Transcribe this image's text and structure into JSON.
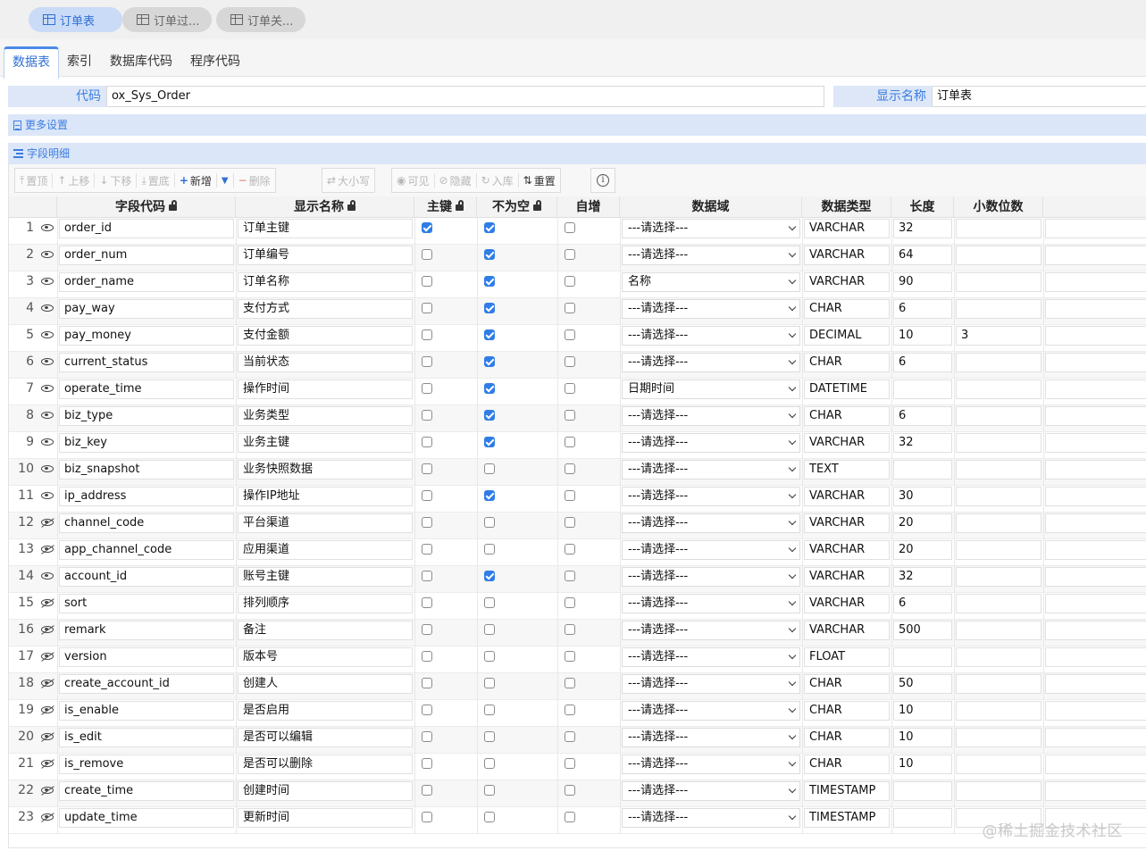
{
  "top_tabs": [
    {
      "label": "订单表",
      "active": true
    },
    {
      "label": "订单过...",
      "active": false
    },
    {
      "label": "订单关...",
      "active": false
    }
  ],
  "sub_tabs": [
    "数据表",
    "索引",
    "数据库代码",
    "程序代码"
  ],
  "form": {
    "code_label": "代码",
    "code_value": "ox_Sys_Order",
    "display_label": "显示名称",
    "display_value": "订单表"
  },
  "sections": {
    "more_settings": "更多设置",
    "field_detail": "字段明细"
  },
  "toolbar": {
    "top": "置顶",
    "up": "上移",
    "down": "下移",
    "bottom": "置底",
    "add": "新增",
    "delete": "删除",
    "case": "大小写",
    "visible": "可见",
    "hide": "隐藏",
    "into_db": "入库",
    "reset": "重置"
  },
  "columns": {
    "code": "字段代码",
    "name": "显示名称",
    "pk": "主键",
    "not_null": "不为空",
    "auto": "自增",
    "domain": "数据域",
    "type": "数据类型",
    "length": "长度",
    "scale": "小数位数"
  },
  "rows": [
    {
      "num": "1",
      "visible": true,
      "code": "order_id",
      "name": "订单主键",
      "pk": true,
      "not_null": true,
      "auto": false,
      "domain": "---请选择---",
      "type": "VARCHAR",
      "length": "32",
      "scale": ""
    },
    {
      "num": "2",
      "visible": true,
      "code": "order_num",
      "name": "订单编号",
      "pk": false,
      "not_null": true,
      "auto": false,
      "domain": "---请选择---",
      "type": "VARCHAR",
      "length": "64",
      "scale": ""
    },
    {
      "num": "3",
      "visible": true,
      "code": "order_name",
      "name": "订单名称",
      "pk": false,
      "not_null": true,
      "auto": false,
      "domain": "名称",
      "type": "VARCHAR",
      "length": "90",
      "scale": ""
    },
    {
      "num": "4",
      "visible": true,
      "code": "pay_way",
      "name": "支付方式",
      "pk": false,
      "not_null": true,
      "auto": false,
      "domain": "---请选择---",
      "type": "CHAR",
      "length": "6",
      "scale": ""
    },
    {
      "num": "5",
      "visible": true,
      "code": "pay_money",
      "name": "支付金额",
      "pk": false,
      "not_null": true,
      "auto": false,
      "domain": "---请选择---",
      "type": "DECIMAL",
      "length": "10",
      "scale": "3"
    },
    {
      "num": "6",
      "visible": true,
      "code": "current_status",
      "name": "当前状态",
      "pk": false,
      "not_null": true,
      "auto": false,
      "domain": "---请选择---",
      "type": "CHAR",
      "length": "6",
      "scale": ""
    },
    {
      "num": "7",
      "visible": true,
      "code": "operate_time",
      "name": "操作时间",
      "pk": false,
      "not_null": true,
      "auto": false,
      "domain": "日期时间",
      "type": "DATETIME",
      "length": "",
      "scale": ""
    },
    {
      "num": "8",
      "visible": true,
      "code": "biz_type",
      "name": "业务类型",
      "pk": false,
      "not_null": true,
      "auto": false,
      "domain": "---请选择---",
      "type": "CHAR",
      "length": "6",
      "scale": ""
    },
    {
      "num": "9",
      "visible": true,
      "code": "biz_key",
      "name": "业务主键",
      "pk": false,
      "not_null": true,
      "auto": false,
      "domain": "---请选择---",
      "type": "VARCHAR",
      "length": "32",
      "scale": ""
    },
    {
      "num": "10",
      "visible": true,
      "code": "biz_snapshot",
      "name": "业务快照数据",
      "pk": false,
      "not_null": false,
      "auto": false,
      "domain": "---请选择---",
      "type": "TEXT",
      "length": "",
      "scale": ""
    },
    {
      "num": "11",
      "visible": true,
      "code": "ip_address",
      "name": "操作IP地址",
      "pk": false,
      "not_null": true,
      "auto": false,
      "domain": "---请选择---",
      "type": "VARCHAR",
      "length": "30",
      "scale": ""
    },
    {
      "num": "12",
      "visible": false,
      "code": "channel_code",
      "name": "平台渠道",
      "pk": false,
      "not_null": false,
      "auto": false,
      "domain": "---请选择---",
      "type": "VARCHAR",
      "length": "20",
      "scale": ""
    },
    {
      "num": "13",
      "visible": false,
      "code": "app_channel_code",
      "name": "应用渠道",
      "pk": false,
      "not_null": false,
      "auto": false,
      "domain": "---请选择---",
      "type": "VARCHAR",
      "length": "20",
      "scale": ""
    },
    {
      "num": "14",
      "visible": true,
      "code": "account_id",
      "name": "账号主键",
      "pk": false,
      "not_null": true,
      "auto": false,
      "domain": "---请选择---",
      "type": "VARCHAR",
      "length": "32",
      "scale": ""
    },
    {
      "num": "15",
      "visible": false,
      "code": "sort",
      "name": "排列顺序",
      "pk": false,
      "not_null": false,
      "auto": false,
      "domain": "---请选择---",
      "type": "VARCHAR",
      "length": "6",
      "scale": ""
    },
    {
      "num": "16",
      "visible": false,
      "code": "remark",
      "name": "备注",
      "pk": false,
      "not_null": false,
      "auto": false,
      "domain": "---请选择---",
      "type": "VARCHAR",
      "length": "500",
      "scale": ""
    },
    {
      "num": "17",
      "visible": false,
      "code": "version",
      "name": "版本号",
      "pk": false,
      "not_null": false,
      "auto": false,
      "domain": "---请选择---",
      "type": "FLOAT",
      "length": "",
      "scale": ""
    },
    {
      "num": "18",
      "visible": false,
      "code": "create_account_id",
      "name": "创建人",
      "pk": false,
      "not_null": false,
      "auto": false,
      "domain": "---请选择---",
      "type": "CHAR",
      "length": "50",
      "scale": ""
    },
    {
      "num": "19",
      "visible": false,
      "code": "is_enable",
      "name": "是否启用",
      "pk": false,
      "not_null": false,
      "auto": false,
      "domain": "---请选择---",
      "type": "CHAR",
      "length": "10",
      "scale": ""
    },
    {
      "num": "20",
      "visible": false,
      "code": "is_edit",
      "name": "是否可以编辑",
      "pk": false,
      "not_null": false,
      "auto": false,
      "domain": "---请选择---",
      "type": "CHAR",
      "length": "10",
      "scale": ""
    },
    {
      "num": "21",
      "visible": false,
      "code": "is_remove",
      "name": "是否可以删除",
      "pk": false,
      "not_null": false,
      "auto": false,
      "domain": "---请选择---",
      "type": "CHAR",
      "length": "10",
      "scale": ""
    },
    {
      "num": "22",
      "visible": false,
      "code": "create_time",
      "name": "创建时间",
      "pk": false,
      "not_null": false,
      "auto": false,
      "domain": "---请选择---",
      "type": "TIMESTAMP",
      "length": "",
      "scale": ""
    },
    {
      "num": "23",
      "visible": false,
      "code": "update_time",
      "name": "更新时间",
      "pk": false,
      "not_null": false,
      "auto": false,
      "domain": "---请选择---",
      "type": "TIMESTAMP",
      "length": "",
      "scale": ""
    }
  ],
  "watermark": "@稀土掘金技术社区",
  "colors": {
    "accent": "#2f7de6",
    "label_bg": "#dde7f8",
    "label_text": "#3c7de0"
  }
}
